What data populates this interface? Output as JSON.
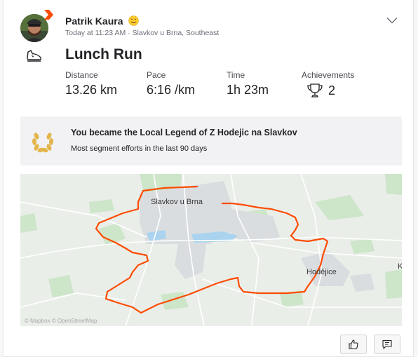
{
  "athlete": {
    "name": "Patrik Kaura",
    "emoji": "face-savoring-food-emoji",
    "timestamp": "Today at 11:23 AM",
    "location": "Slavkov u Brna, Southeast",
    "meta_separator": " · "
  },
  "activity": {
    "type_icon": "running-shoe-icon",
    "title": "Lunch Run",
    "stats": [
      {
        "label": "Distance",
        "value": "13.26 km"
      },
      {
        "label": "Pace",
        "value": "6:16 /km"
      },
      {
        "label": "Time",
        "value": "1h 23m"
      },
      {
        "label": "Achievements",
        "value": "2",
        "icon": "trophy-icon"
      }
    ]
  },
  "local_legend": {
    "icon": "laurel-icon",
    "title": "You became the Local Legend of Z Hodejic na Slavkov",
    "subtitle": "Most segment efforts in the last 90 days"
  },
  "map": {
    "labels": [
      "Slavkov u Brna",
      "Hodějice",
      "K"
    ],
    "route_color": "#fc4c02",
    "attribution": "© Mapbox © OpenStreetMap"
  },
  "actions": {
    "kudos_icon": "thumbs-up-icon",
    "comment_icon": "comment-icon"
  },
  "colors": {
    "brand": "#fc4c02",
    "text": "#242428",
    "muted": "#6d6d78"
  }
}
